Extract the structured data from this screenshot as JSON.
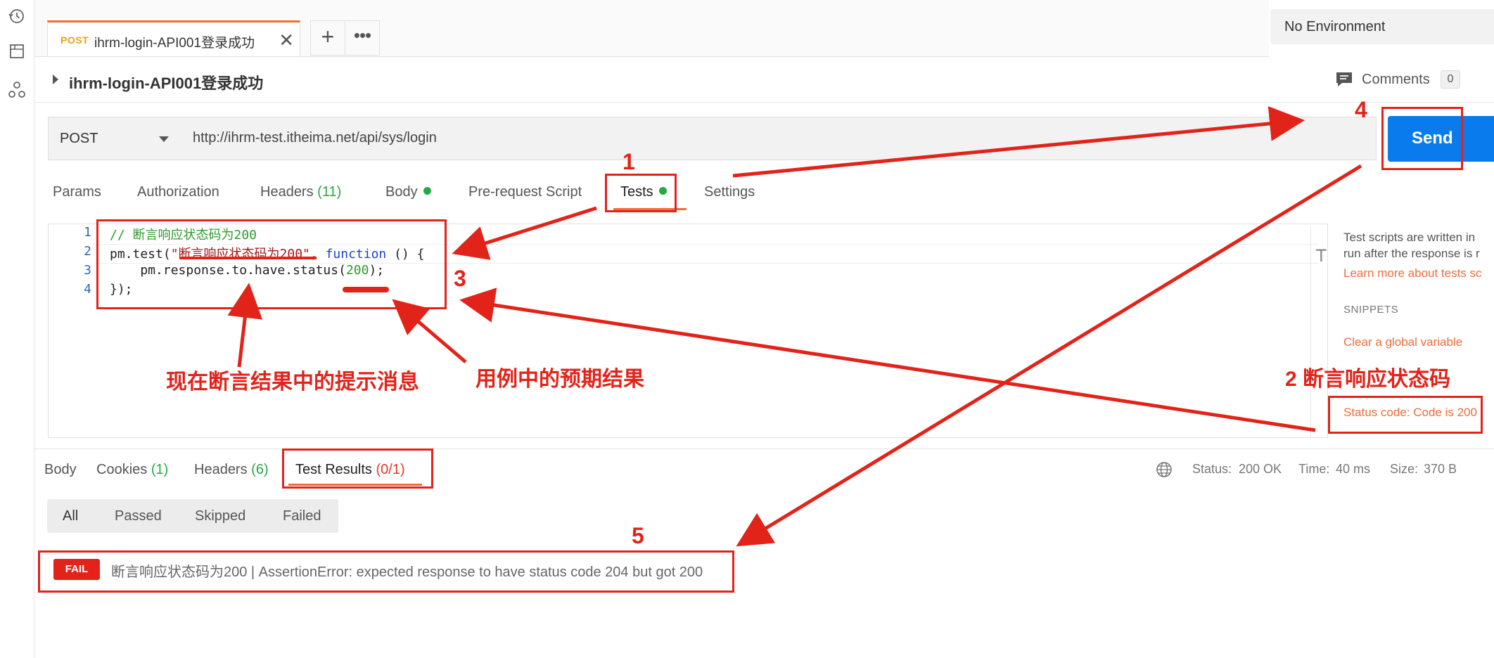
{
  "tab": {
    "method": "POST",
    "name": "ihrm-login-API001登录成功",
    "close": "✕",
    "add": "+",
    "more": "•••"
  },
  "environment": {
    "label": "No Environment"
  },
  "request": {
    "name": "ihrm-login-API001登录成功",
    "comments_label": "Comments",
    "comments_count": "0",
    "method": "POST",
    "url": "http://ihrm-test.itheima.net/api/sys/login",
    "send_label": "Send"
  },
  "request_tabs": {
    "params": "Params",
    "authorization": "Authorization",
    "headers": "Headers",
    "headers_count": "(11)",
    "body": "Body",
    "pre_request": "Pre-request Script",
    "tests": "Tests",
    "settings": "Settings"
  },
  "editor": {
    "line_numbers": [
      "1",
      "2",
      "3",
      "4"
    ],
    "line1": "// 断言响应状态码为200",
    "line2_a": "pm.test(",
    "line2_str": "\"断言响应状态码为200\"",
    "line2_b": ", ",
    "line2_kw": "function",
    "line2_c": " () {",
    "line3_a": "    pm.response.to.have.status(",
    "line3_num": "200",
    "line3_b": ");",
    "line4": "});"
  },
  "help": {
    "text1": "Test scripts are written in",
    "text2": "run after the response is r",
    "learn_more": "Learn more about tests sc",
    "snippets_title": "SNIPPETS",
    "snippet1": "Clear a global variable",
    "snippet2": "Status code: Code is 200"
  },
  "response_tabs": {
    "body": "Body",
    "cookies": "Cookies",
    "cookies_count": "(1)",
    "headers": "Headers",
    "headers_count": "(6)",
    "test_results": "Test Results",
    "test_results_count": "(0/1)"
  },
  "status": {
    "status_label": "Status:",
    "status_value": "200 OK",
    "time_label": "Time:",
    "time_value": "40 ms",
    "size_label": "Size:",
    "size_value": "370 B"
  },
  "filters": [
    "All",
    "Passed",
    "Skipped",
    "Failed"
  ],
  "result": {
    "badge": "FAIL",
    "message": "断言响应状态码为200 | AssertionError: expected response to have status code 204 but got 200"
  },
  "annotations": {
    "n1": "1",
    "n2": "2 断言响应状态码",
    "n3": "3",
    "n4": "4",
    "n5": "5",
    "hint_message": "现在断言结果中的提示消息",
    "hint_expected": "用例中的预期结果"
  },
  "colors": {
    "accent": "#f26b3a",
    "send": "#097bed",
    "success": "#27a745",
    "fail": "#e2231a",
    "annotation": "#e2231a"
  }
}
